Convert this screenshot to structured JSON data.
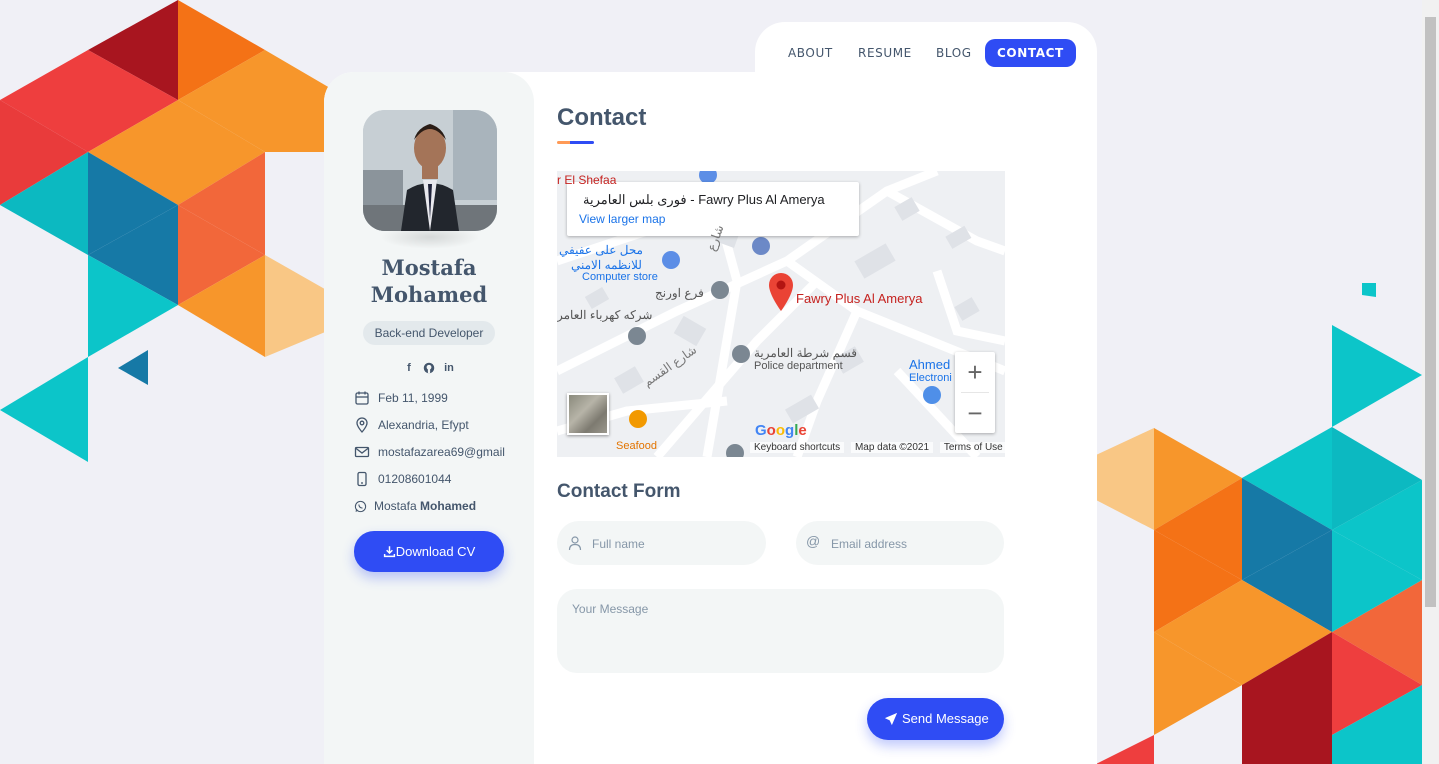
{
  "nav": {
    "items": [
      "ABOUT",
      "RESUME",
      "BLOG",
      "CONTACT"
    ],
    "active": "CONTACT",
    "accent": "#2f4cf4"
  },
  "profile": {
    "name_line1": "Mostafa",
    "name_line2": "Mohamed",
    "role": "Back-end Developer",
    "socials": [
      "facebook-icon",
      "github-icon",
      "linkedin-icon"
    ],
    "birthday": "Feb 11, 1999",
    "location": "Alexandria, Efypt",
    "email": "mostafazarea69@gmail",
    "phone": "01208601044",
    "whatsapp_first": "Mostafa",
    "whatsapp_last": "Mohamed",
    "download_label": "Download CV"
  },
  "contact": {
    "title": "Contact",
    "form_title": "Contact Form",
    "name_placeholder": "Full name",
    "email_placeholder": "Email address",
    "message_placeholder": "Your Message",
    "send_label": "Send Message"
  },
  "map": {
    "place_title": "فوری بلس العامرية - Fawry Plus Al Amerya",
    "larger_map": "View larger map",
    "pin_label": "Fawry Plus Al Amerya",
    "labels": {
      "store_ar": "محل على عفيفي",
      "store_ar2": "للانظمه الامني",
      "store_en": "Computer store",
      "orange_ar": "فرع اورنج",
      "electric_ar": "شركه كهرباء العامر",
      "police_ar": "قسم شرطة العامرية",
      "police_en": "Police department",
      "ahmed": "Ahmed",
      "electronic": "Electroni",
      "seafood": "Seafood",
      "shefaa": "r El Shefaa",
      "street_ar": "شارع القسم",
      "street_ar2": "شارع"
    },
    "zoom_in": "+",
    "zoom_out": "−",
    "footer_shortcuts": "Keyboard shortcuts",
    "footer_data": "Map data ©2021",
    "footer_terms": "Terms of Use",
    "google": "Google"
  }
}
